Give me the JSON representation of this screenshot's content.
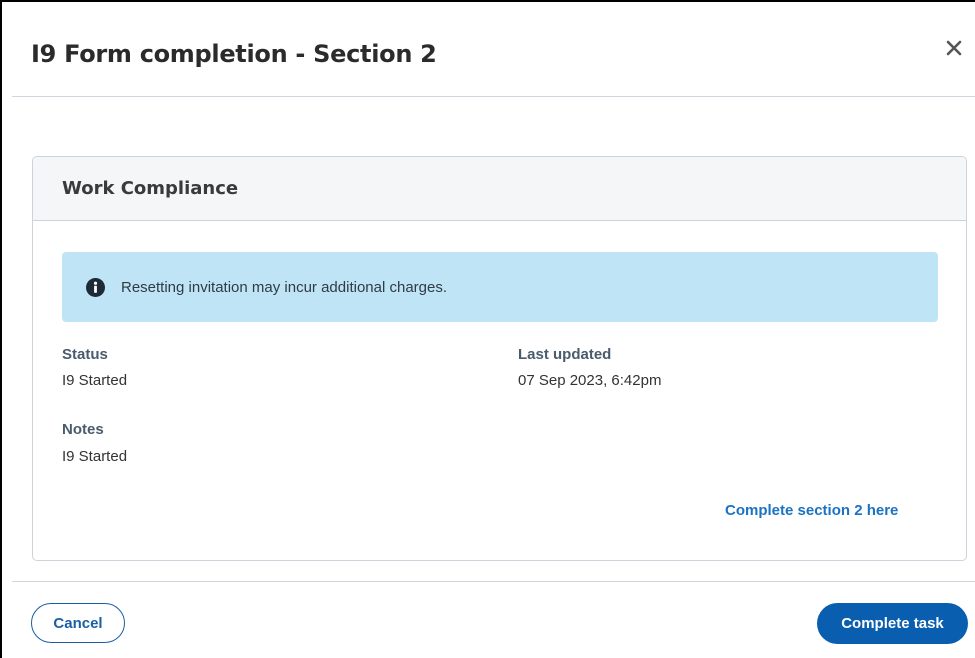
{
  "modal": {
    "title": "I9 Form completion - Section 2",
    "close_icon": "close-icon"
  },
  "card": {
    "title": "Work Compliance",
    "alert": {
      "icon": "info-icon",
      "message": "Resetting invitation may incur additional charges."
    },
    "fields": {
      "status_label": "Status",
      "status_value": "I9 Started",
      "last_updated_label": "Last updated",
      "last_updated_value": "07 Sep 2023, 6:42pm",
      "notes_label": "Notes",
      "notes_value": "I9 Started"
    },
    "link_label": "Complete section 2 here"
  },
  "footer": {
    "cancel_label": "Cancel",
    "complete_label": "Complete task"
  },
  "colors": {
    "primary": "#0a5eb0",
    "link": "#1a73c2",
    "alert_bg": "#bfe4f5"
  }
}
